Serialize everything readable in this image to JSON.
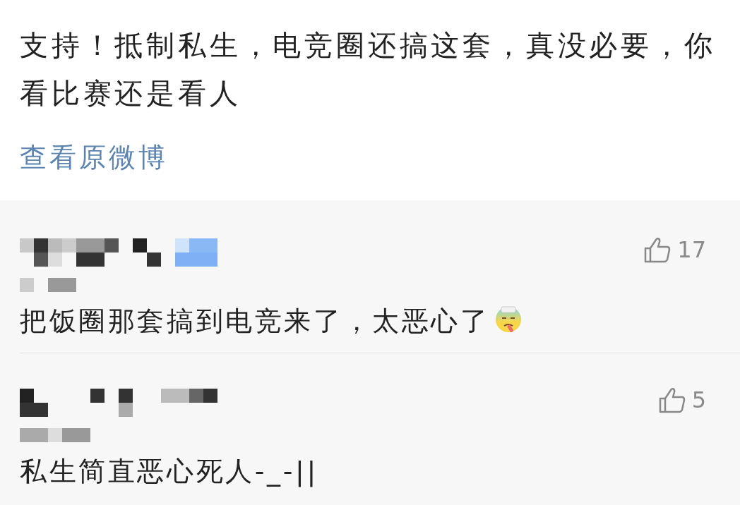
{
  "post": {
    "text": "支持！抵制私生，电竞圈还搞这套，真没必要，你看比赛还是看人",
    "link": "查看原微博"
  },
  "comments": [
    {
      "text": "把饭圈那套搞到电竞来了，太恶心了",
      "likes": "17",
      "has_emoji": true
    },
    {
      "text": "私生简直恶心死人-_-||",
      "likes": "5"
    }
  ]
}
